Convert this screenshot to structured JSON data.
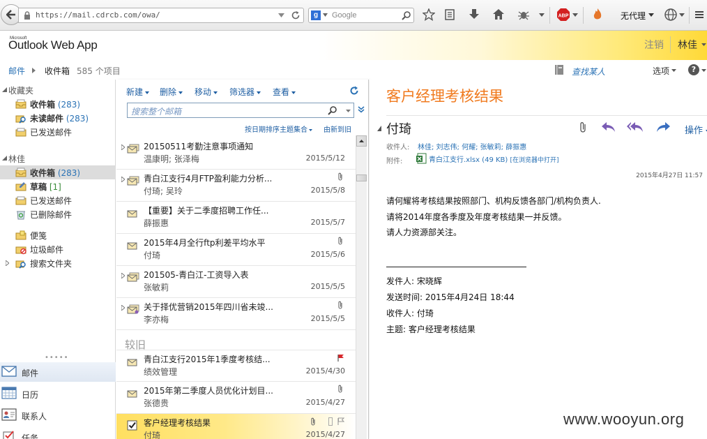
{
  "browser": {
    "url": "https://mail.cdrcb.com/owa/",
    "search_placeholder": "Google",
    "search_engine_badge": "g",
    "proxy_label": "无代理"
  },
  "header": {
    "logo_microsoft": "Microsoft",
    "logo_text": "Outlook Web App",
    "signout": "注销",
    "user_name": "林佳"
  },
  "breadcrumb": {
    "module": "邮件",
    "folder": "收件箱",
    "count": "585 个项目",
    "find_someone": "查找某人",
    "options": "选项",
    "help": "?"
  },
  "nav": {
    "favorites_label": "收藏夹",
    "favorites": [
      {
        "label": "收件箱",
        "count": "(283)",
        "bold": true
      },
      {
        "label": "未读邮件",
        "count": "(283)",
        "bold": true
      },
      {
        "label": "已发送邮件",
        "count": "",
        "bold": false
      }
    ],
    "mailbox_label": "林佳",
    "folders": [
      {
        "label": "收件箱",
        "count": "(283)"
      },
      {
        "label": "草稿",
        "count": "[1]"
      },
      {
        "label": "已发送邮件",
        "count": ""
      },
      {
        "label": "已删除邮件",
        "count": ""
      },
      {
        "label": "便笺",
        "count": ""
      },
      {
        "label": "垃圾邮件",
        "count": ""
      },
      {
        "label": "搜索文件夹",
        "count": ""
      }
    ],
    "modules": [
      {
        "label": "邮件"
      },
      {
        "label": "日历"
      },
      {
        "label": "联系人"
      },
      {
        "label": "任务"
      }
    ]
  },
  "list": {
    "toolbar": {
      "new": "新建",
      "delete": "删除",
      "move": "移动",
      "filter": "筛选器",
      "view": "查看"
    },
    "search_placeholder": "搜索整个邮箱",
    "sort_label": "按日期排序主题集合",
    "order_label": "由新到旧",
    "group_older": "较旧",
    "messages": [
      {
        "subject": "20150511考勤注意事项通知",
        "from": "温康明; 张泽梅",
        "date": "2015/5/12",
        "attach": false
      },
      {
        "subject": "青白江支行4月FTP盈利能力分析...",
        "from": "付琦; 吴玲",
        "date": "2015/5/8",
        "attach": true
      },
      {
        "subject": "【重要】关于二季度招聘工作任...",
        "from": "薛振惠",
        "date": "2015/5/7",
        "attach": false
      },
      {
        "subject": "2015年4月全行ftp利差平均水平",
        "from": "付琦",
        "date": "2015/5/6",
        "attach": true
      },
      {
        "subject": "201505-青白江-工资导入表",
        "from": "张敏莉",
        "date": "2015/5/5",
        "attach": false
      },
      {
        "subject": "关于择优营销2015年四川省未竣...",
        "from": "李亦梅",
        "date": "2015/5/5",
        "attach": true
      },
      {
        "subject": "青白江支行2015年1季度考核结...",
        "from": "绩效管理",
        "date": "2015/4/30",
        "attach": false
      },
      {
        "subject": "2015年第二季度人员优化计划目...",
        "from": "张德贵",
        "date": "2015/4/27",
        "attach": true
      },
      {
        "subject": "客户经理考核结果",
        "from": "付琦",
        "date": "2015/4/27",
        "attach": true
      }
    ]
  },
  "reading": {
    "subject": "客户经理考核结果",
    "sender": "付琦",
    "actions_label": "操作",
    "to_label": "收件人:",
    "to_value": "林佳; 刘志伟; 何耀; 张敏莉; 薛振惠",
    "attach_label": "附件:",
    "attach_name": "青白江支行.xlsx (49 KB)",
    "attach_open": "[在浏览器中打开]",
    "sent_date": "2015年4月27日 11:57",
    "body": [
      "请何耀将考核结果按照部门、机构反馈各部门/机构负责人.",
      "请将2014年度各季度及年度考核结果一并反馈。",
      "请人力资源部关注。"
    ],
    "quoted": [
      "发件人: 宋晓辉",
      "发送时间: 2015年4月24日 18:44",
      "收件人: 付琦",
      "主题: 客户经理考核结果"
    ]
  },
  "watermark": "www.wooyun.org"
}
